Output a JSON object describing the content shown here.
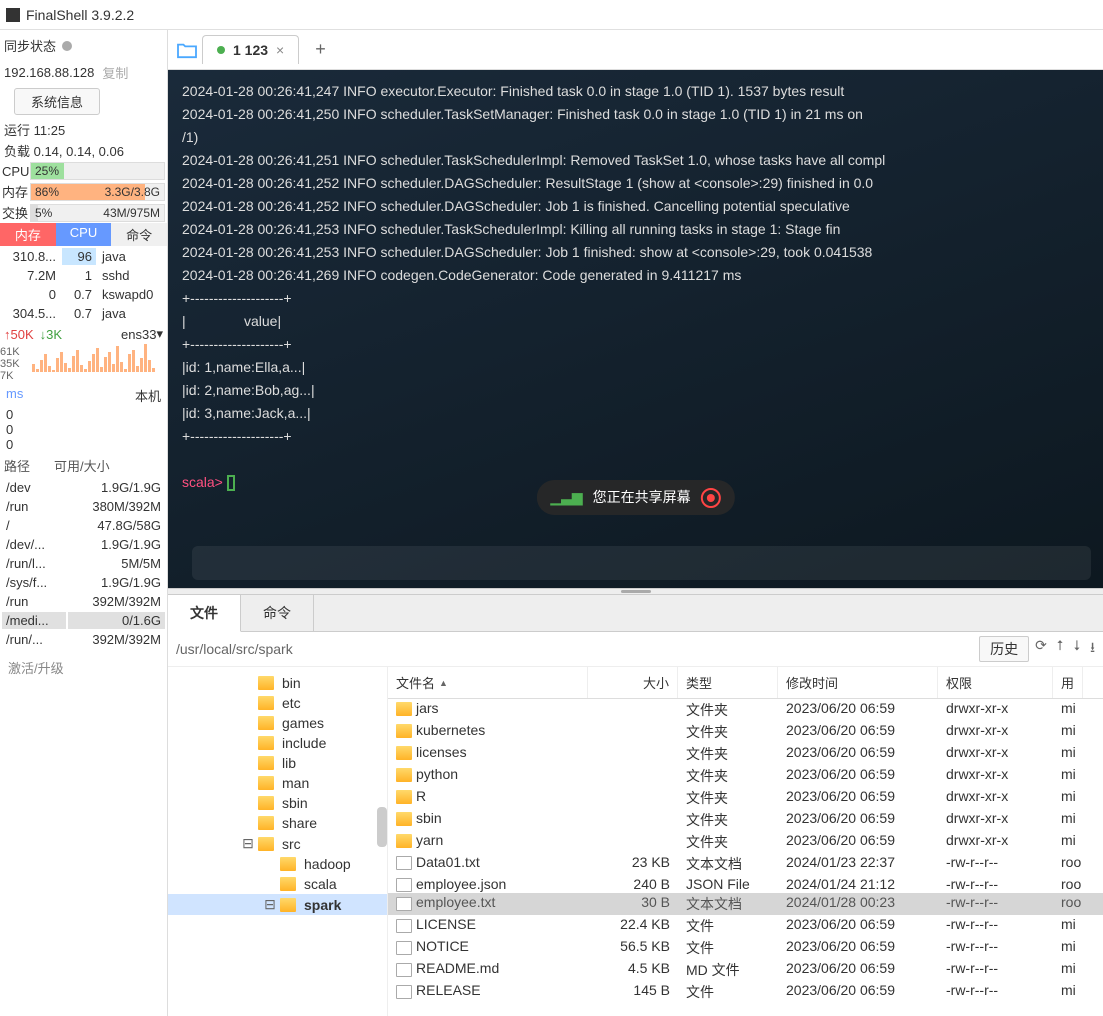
{
  "title": "FinalShell 3.9.2.2",
  "sidebar": {
    "sync_label": "同步状态",
    "ip": "192.168.88.128",
    "copy": "复制",
    "sysinfo_btn": "系统信息",
    "runtime_label": "运行 11:25",
    "load_label": "负载 0.14, 0.14, 0.06",
    "cpu": {
      "label": "CPU",
      "pct": "25%",
      "width": 25
    },
    "mem": {
      "label": "内存",
      "pct": "86%",
      "detail": "3.3G/3.8G",
      "width": 86
    },
    "swap": {
      "label": "交换",
      "pct": "5%",
      "detail": "43M/975M",
      "width": 5
    },
    "tabs": {
      "mem": "内存",
      "cpu": "CPU",
      "cmd": "命令"
    },
    "procs": [
      {
        "mem": "310.8...",
        "cpu": "96",
        "name": "java",
        "hl": true
      },
      {
        "mem": "7.2M",
        "cpu": "1",
        "name": "sshd",
        "hl": false
      },
      {
        "mem": "0",
        "cpu": "0.7",
        "name": "kswapd0",
        "hl": false
      },
      {
        "mem": "304.5...",
        "cpu": "0.7",
        "name": "java",
        "hl": false
      }
    ],
    "net": {
      "up": "↑50K",
      "down": "↓3K",
      "if": "ens33"
    },
    "scale": [
      "61K",
      "35K",
      "7K"
    ],
    "ms": "ms",
    "local": "本机",
    "ms_vals": [
      "0",
      "0",
      "0"
    ],
    "disk_hdr": {
      "path": "路径",
      "avail": "可用/大小"
    },
    "disks": [
      {
        "p": "/dev",
        "v": "1.9G/1.9G"
      },
      {
        "p": "/run",
        "v": "380M/392M"
      },
      {
        "p": "/",
        "v": "47.8G/58G"
      },
      {
        "p": "/dev/...",
        "v": "1.9G/1.9G"
      },
      {
        "p": "/run/l...",
        "v": "5M/5M"
      },
      {
        "p": "/sys/f...",
        "v": "1.9G/1.9G"
      },
      {
        "p": "/run",
        "v": "392M/392M"
      },
      {
        "p": "/medi...",
        "v": "0/1.6G",
        "hl": true
      },
      {
        "p": "/run/...",
        "v": "392M/392M"
      }
    ],
    "activate": "激活/升级"
  },
  "tab": {
    "label": "1 123"
  },
  "terminal_lines": [
    "2024-01-28 00:26:41,247 INFO executor.Executor: Finished task 0.0 in stage 1.0 (TID 1). 1537 bytes result",
    "2024-01-28 00:26:41,250 INFO scheduler.TaskSetManager: Finished task 0.0 in stage 1.0 (TID 1) in 21 ms on",
    "/1)",
    "2024-01-28 00:26:41,251 INFO scheduler.TaskSchedulerImpl: Removed TaskSet 1.0, whose tasks have all compl",
    "2024-01-28 00:26:41,252 INFO scheduler.DAGScheduler: ResultStage 1 (show at <console>:29) finished in 0.0",
    "2024-01-28 00:26:41,252 INFO scheduler.DAGScheduler: Job 1 is finished. Cancelling potential speculative ",
    "2024-01-28 00:26:41,253 INFO scheduler.TaskSchedulerImpl: Killing all running tasks in stage 1: Stage fin",
    "2024-01-28 00:26:41,253 INFO scheduler.DAGScheduler: Job 1 finished: show at <console>:29, took 0.041538 ",
    "2024-01-28 00:26:41,269 INFO codegen.CodeGenerator: Code generated in 9.411217 ms",
    "+--------------------+",
    "|               value|",
    "+--------------------+",
    "|id: 1,name:Ella,a...|",
    "|id: 2,name:Bob,ag...|",
    "|id: 3,name:Jack,a...|",
    "+--------------------+",
    ""
  ],
  "prompt": "scala>",
  "share_text": "您正在共享屏幕",
  "fp": {
    "tab_file": "文件",
    "tab_cmd": "命令",
    "path": "/usr/local/src/spark",
    "history": "历史",
    "headers": {
      "name": "文件名",
      "size": "大小",
      "type": "类型",
      "date": "修改时间",
      "perm": "权限",
      "user": "用"
    },
    "tree": [
      {
        "indent": 2,
        "name": "bin"
      },
      {
        "indent": 2,
        "name": "etc"
      },
      {
        "indent": 2,
        "name": "games"
      },
      {
        "indent": 2,
        "name": "include"
      },
      {
        "indent": 2,
        "name": "lib"
      },
      {
        "indent": 2,
        "name": "man"
      },
      {
        "indent": 2,
        "name": "sbin"
      },
      {
        "indent": 2,
        "name": "share"
      },
      {
        "indent": 2,
        "name": "src",
        "switch": "⊟"
      },
      {
        "indent": 3,
        "name": "hadoop"
      },
      {
        "indent": 3,
        "name": "scala"
      },
      {
        "indent": 3,
        "name": "spark",
        "switch": "⊟",
        "sel": true
      }
    ],
    "files": [
      {
        "icon": "folder",
        "name": "jars",
        "size": "",
        "type": "文件夹",
        "date": "2023/06/20 06:59",
        "perm": "drwxr-xr-x",
        "user": "mi"
      },
      {
        "icon": "folder",
        "name": "kubernetes",
        "size": "",
        "type": "文件夹",
        "date": "2023/06/20 06:59",
        "perm": "drwxr-xr-x",
        "user": "mi"
      },
      {
        "icon": "folder",
        "name": "licenses",
        "size": "",
        "type": "文件夹",
        "date": "2023/06/20 06:59",
        "perm": "drwxr-xr-x",
        "user": "mi"
      },
      {
        "icon": "folder",
        "name": "python",
        "size": "",
        "type": "文件夹",
        "date": "2023/06/20 06:59",
        "perm": "drwxr-xr-x",
        "user": "mi"
      },
      {
        "icon": "folder",
        "name": "R",
        "size": "",
        "type": "文件夹",
        "date": "2023/06/20 06:59",
        "perm": "drwxr-xr-x",
        "user": "mi"
      },
      {
        "icon": "folder",
        "name": "sbin",
        "size": "",
        "type": "文件夹",
        "date": "2023/06/20 06:59",
        "perm": "drwxr-xr-x",
        "user": "mi"
      },
      {
        "icon": "folder",
        "name": "yarn",
        "size": "",
        "type": "文件夹",
        "date": "2023/06/20 06:59",
        "perm": "drwxr-xr-x",
        "user": "mi"
      },
      {
        "icon": "file",
        "name": "Data01.txt",
        "size": "23 KB",
        "type": "文本文档",
        "date": "2024/01/23 22:37",
        "perm": "-rw-r--r--",
        "user": "roo"
      },
      {
        "icon": "file",
        "name": "employee.json",
        "size": "240 B",
        "type": "JSON File",
        "date": "2024/01/24 21:12",
        "perm": "-rw-r--r--",
        "user": "roo"
      },
      {
        "icon": "file",
        "name": "employee.txt",
        "size": "30 B",
        "type": "文本文档",
        "date": "2024/01/28 00:23",
        "perm": "-rw-r--r--",
        "user": "roo",
        "sel": true
      },
      {
        "icon": "file",
        "name": "LICENSE",
        "size": "22.4 KB",
        "type": "文件",
        "date": "2023/06/20 06:59",
        "perm": "-rw-r--r--",
        "user": "mi"
      },
      {
        "icon": "file",
        "name": "NOTICE",
        "size": "56.5 KB",
        "type": "文件",
        "date": "2023/06/20 06:59",
        "perm": "-rw-r--r--",
        "user": "mi"
      },
      {
        "icon": "file",
        "name": "README.md",
        "size": "4.5 KB",
        "type": "MD 文件",
        "date": "2023/06/20 06:59",
        "perm": "-rw-r--r--",
        "user": "mi"
      },
      {
        "icon": "file",
        "name": "RELEASE",
        "size": "145 B",
        "type": "文件",
        "date": "2023/06/20 06:59",
        "perm": "-rw-r--r--",
        "user": "mi"
      }
    ]
  }
}
